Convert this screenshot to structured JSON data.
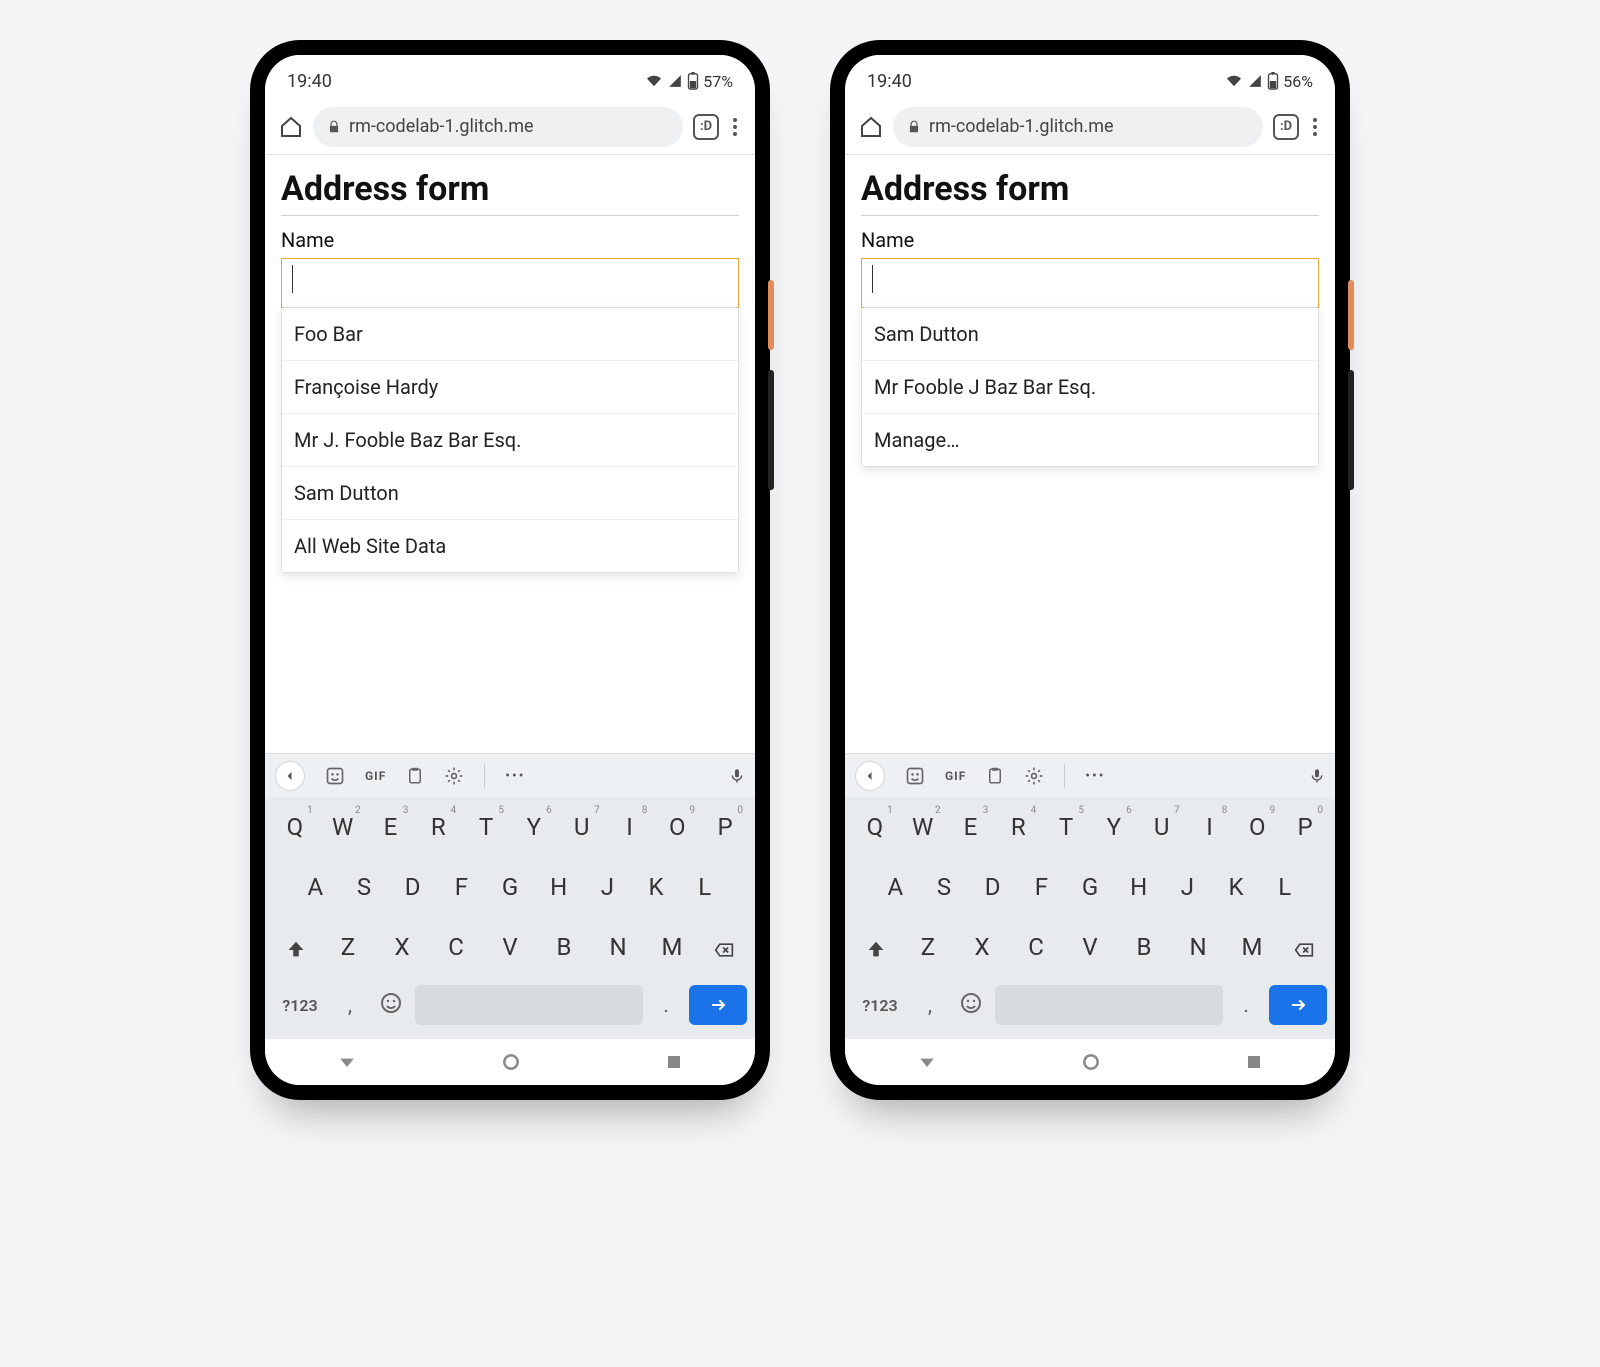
{
  "phones": [
    {
      "status": {
        "time": "19:40",
        "battery": "57%"
      },
      "browser": {
        "url": "rm-codelab-1.glitch.me",
        "tabcount": ":D"
      },
      "page": {
        "title": "Address form",
        "label": "Name",
        "input_value": "",
        "suggestions": [
          "Foo Bar",
          "Françoise Hardy",
          "Mr J. Fooble Baz Bar Esq.",
          "Sam Dutton",
          "All Web Site Data"
        ]
      }
    },
    {
      "status": {
        "time": "19:40",
        "battery": "56%"
      },
      "browser": {
        "url": "rm-codelab-1.glitch.me",
        "tabcount": ":D"
      },
      "page": {
        "title": "Address form",
        "label": "Name",
        "input_value": "",
        "suggestions": [
          "Sam Dutton",
          "Mr Fooble J Baz Bar Esq.",
          "Manage…"
        ]
      }
    }
  ],
  "keyboard": {
    "toolbar": {
      "gif": "GIF"
    },
    "row1": [
      "Q",
      "W",
      "E",
      "R",
      "T",
      "Y",
      "U",
      "I",
      "O",
      "P"
    ],
    "row1sup": [
      "1",
      "2",
      "3",
      "4",
      "5",
      "6",
      "7",
      "8",
      "9",
      "0"
    ],
    "row2": [
      "A",
      "S",
      "D",
      "F",
      "G",
      "H",
      "J",
      "K",
      "L"
    ],
    "row3": [
      "Z",
      "X",
      "C",
      "V",
      "B",
      "N",
      "M"
    ],
    "symkey": "?123",
    "comma": ",",
    "period": "."
  }
}
